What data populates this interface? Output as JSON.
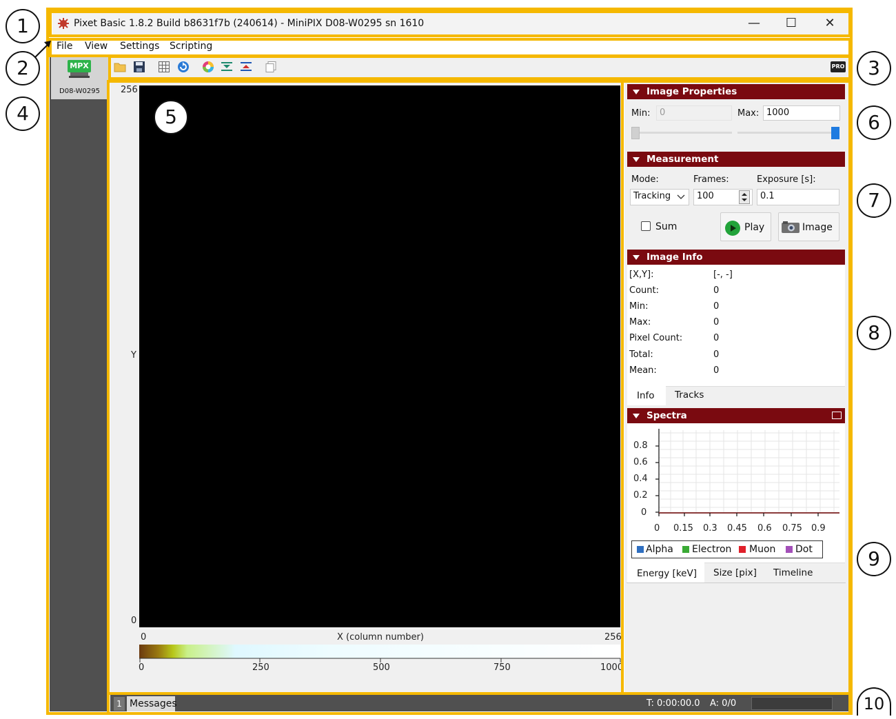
{
  "window": {
    "title": "Pixet Basic 1.8.2 Build b8631f7b (240614) - MiniPIX D08-W0295 sn 1610",
    "minimize": "—",
    "maximize": "☐",
    "close": "✕"
  },
  "menu": [
    "File",
    "View",
    "Settings",
    "Scripting"
  ],
  "toolbar": {
    "icons": [
      "open-folder-icon",
      "save-icon",
      "grid-icon",
      "refresh-icon",
      "color-wheel-icon",
      "flip-vertical-icon",
      "flip-horizontal-icon",
      "copy-icon"
    ],
    "badge": "PRO"
  },
  "device": {
    "logo": "MPX",
    "name": "D08-W0295"
  },
  "image": {
    "y_axis_label": "Y",
    "y_max": "256",
    "y_min": "0",
    "x_axis_label": "X (column number)",
    "x_min": "0",
    "x_max": "256",
    "colorbar_ticks": [
      "0",
      "250",
      "500",
      "750",
      "1000"
    ]
  },
  "image_properties": {
    "header": "Image Properties",
    "min_label": "Min:",
    "min_value": "0",
    "max_label": "Max:",
    "max_value": "1000"
  },
  "measurement": {
    "header": "Measurement",
    "mode_label": "Mode:",
    "mode_value": "Tracking",
    "frames_label": "Frames:",
    "frames_value": "100",
    "exposure_label": "Exposure [s]:",
    "exposure_value": "0.1",
    "sum_label": "Sum",
    "play_label": "Play",
    "image_label": "Image"
  },
  "image_info": {
    "header": "Image Info",
    "rows": [
      {
        "label": "[X,Y]:",
        "value": "[-, -]"
      },
      {
        "label": "Count:",
        "value": "0"
      },
      {
        "label": "Min:",
        "value": "0"
      },
      {
        "label": "Max:",
        "value": "0"
      },
      {
        "label": "Pixel Count:",
        "value": "0"
      },
      {
        "label": "Total:",
        "value": "0"
      },
      {
        "label": "Mean:",
        "value": "0"
      }
    ],
    "tabs": [
      "Info",
      "Tracks"
    ]
  },
  "spectra": {
    "header": "Spectra",
    "y_ticks": [
      "0.8",
      "0.6",
      "0.4",
      "0.2",
      "0"
    ],
    "x_ticks": [
      "0",
      "0.15",
      "0.3",
      "0.45",
      "0.6",
      "0.75",
      "0.9"
    ],
    "legend": [
      {
        "name": "Alpha",
        "color": "#2f6fc0"
      },
      {
        "name": "Electron",
        "color": "#3aaa35"
      },
      {
        "name": "Muon",
        "color": "#e0202a"
      },
      {
        "name": "Dot",
        "color": "#a34fb8"
      }
    ],
    "tabs": [
      "Energy [keV]",
      "Size [pix]",
      "Timeline"
    ]
  },
  "status": {
    "count": "1",
    "messages": "Messages",
    "time": "T: 0:00:00.0",
    "acq": "A: 0/0"
  },
  "callouts": [
    "1",
    "2",
    "3",
    "4",
    "5",
    "6",
    "7",
    "8",
    "9",
    "10"
  ],
  "colors": {
    "highlight": "#f5b800",
    "section_header": "#7a0a10",
    "dark_panel": "#505050"
  }
}
